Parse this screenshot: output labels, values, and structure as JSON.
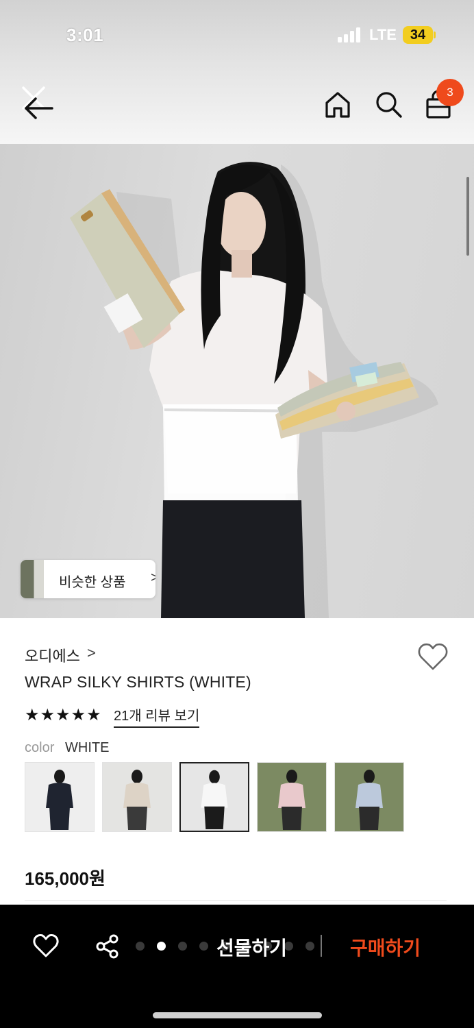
{
  "status_bar": {
    "time": "3:01",
    "network": "LTE",
    "battery": "34"
  },
  "header": {
    "cart_count": "3"
  },
  "hero": {
    "similar_label": "비슷한 상품",
    "similar_chevron": ">"
  },
  "product": {
    "brand": "오디에스",
    "brand_chevron": ">",
    "title": "WRAP SILKY SHIRTS (WHITE)",
    "rating_stars": 5,
    "review_link": "21개 리뷰 보기",
    "color_label": "color",
    "color_value": "WHITE",
    "swatches": [
      {
        "name": "swatch-black",
        "bg": "#eeeeee",
        "top": "#1f2430",
        "bottom": "#1f2430"
      },
      {
        "name": "swatch-beige",
        "bg": "#e4e4e2",
        "top": "#ddd3c6",
        "bottom": "#3a3a3a"
      },
      {
        "name": "swatch-white",
        "bg": "#e6e6e6",
        "top": "#f7f7f7",
        "bottom": "#1b1b1b"
      },
      {
        "name": "swatch-pink",
        "bg": "#7c8a62",
        "top": "#e9c9cc",
        "bottom": "#2b2b2b"
      },
      {
        "name": "swatch-blue",
        "bg": "#7c8a62",
        "top": "#bcc9dc",
        "bottom": "#2b2b2b"
      }
    ],
    "selected_swatch": 2,
    "price": "165,000원"
  },
  "bottom_bar": {
    "gift_label": "선물하기",
    "buy_label": "구매하기",
    "page_dots": 9,
    "active_dot": 1
  },
  "colors": {
    "accent": "#ef4a1c",
    "bar_bg": "#000000"
  }
}
